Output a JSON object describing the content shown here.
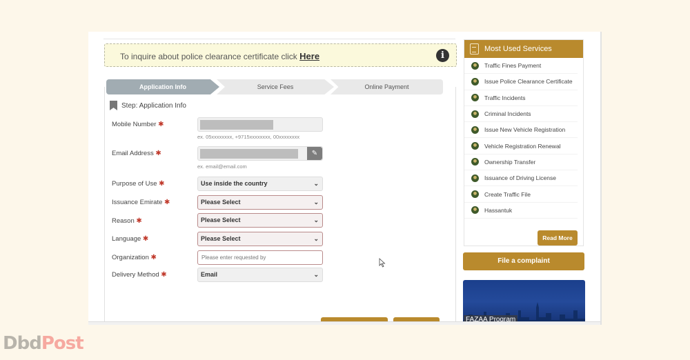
{
  "notice": {
    "text": "To inquire about police clearance certificate click",
    "link": "Here"
  },
  "steps": [
    "Application Info",
    "Service Fees",
    "Online Payment"
  ],
  "active_step": 0,
  "step_title": "Step: Application Info",
  "form": {
    "mobile": {
      "label": "Mobile Number",
      "hint": "ex. 05xxxxxxxx, +9715xxxxxxxx, 00xxxxxxxx"
    },
    "email": {
      "label": "Email Address",
      "hint": "ex. email@email.com"
    },
    "purpose": {
      "label": "Purpose of Use",
      "value": "Use inside the country"
    },
    "emirate": {
      "label": "Issuance Emirate",
      "value": "Please Select"
    },
    "reason": {
      "label": "Reason",
      "value": "Please Select"
    },
    "language": {
      "label": "Language",
      "value": "Please Select"
    },
    "organization": {
      "label": "Organization",
      "placeholder": "Please enter requested by"
    },
    "delivery": {
      "label": "Delivery Method",
      "value": "Email"
    },
    "required_mark": "✱"
  },
  "sidebar": {
    "title": "Most Used Services",
    "services": [
      "Traffic Fines Payment",
      "Issue Police Clearance Certificate",
      "Traffic Incidents",
      "Criminal Incidents",
      "Issue New Vehicle Registration",
      "Vehicle Registration Renewal",
      "Ownership Transfer",
      "Issuance of Driving License",
      "Create Traffic File",
      "Hassantuk"
    ],
    "read_more": "Read More",
    "complaint": "File a complaint",
    "banner": "FAZAA Program"
  },
  "colors": {
    "accent": "#b98a2d",
    "step_active": "#a1acb2",
    "notice_bg": "#fbf9dc"
  },
  "watermark": {
    "part1": "Dbd",
    "part2": "Post"
  }
}
